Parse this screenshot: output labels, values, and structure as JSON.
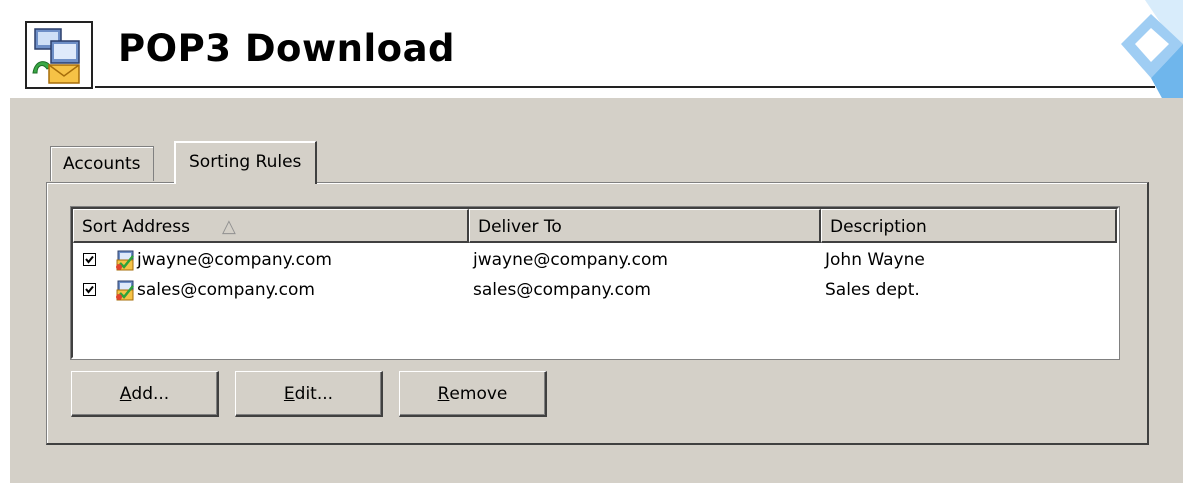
{
  "header": {
    "title": "POP3 Download",
    "icon": "pop3-download-icon"
  },
  "tabs": [
    {
      "label": "Accounts",
      "selected": false
    },
    {
      "label": "Sorting Rules",
      "selected": true
    }
  ],
  "list": {
    "columns": [
      "Sort Address",
      "Deliver To",
      "Description"
    ],
    "sort_column": "Sort Address",
    "sort_direction": "ascending",
    "rows": [
      {
        "checked": true,
        "sort_address": "jwayne@company.com",
        "deliver_to": "jwayne@company.com",
        "description": "John Wayne"
      },
      {
        "checked": true,
        "sort_address": "sales@company.com",
        "deliver_to": "sales@company.com",
        "description": "Sales dept."
      }
    ]
  },
  "buttons": {
    "add_mnemonic": "A",
    "add_rest": "dd...",
    "edit_mnemonic": "E",
    "edit_rest": "dit...",
    "remove_mnemonic": "R",
    "remove_rest": "emove"
  },
  "colors": {
    "panel_bg": "#d4d0c8",
    "accent": "#5aa9e6"
  }
}
